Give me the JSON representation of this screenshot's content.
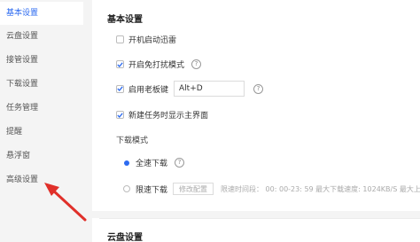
{
  "sidebar": {
    "items": [
      {
        "label": "基本设置",
        "active": true
      },
      {
        "label": "云盘设置"
      },
      {
        "label": "接管设置"
      },
      {
        "label": "下载设置"
      },
      {
        "label": "任务管理"
      },
      {
        "label": "提醒"
      },
      {
        "label": "悬浮窗"
      },
      {
        "label": "高级设置"
      }
    ]
  },
  "basic": {
    "title": "基本设置",
    "autostart": "开机启动迅雷",
    "no_disturb": "开启免打扰模式",
    "boss_key": "启用老板键",
    "boss_key_value": "Alt+D",
    "show_main": "新建任务时显示主界面"
  },
  "download_mode": {
    "title": "下载模式",
    "full_speed": "全速下载",
    "limited": "限速下载",
    "config_button": "修改配置",
    "limit_info": "限速时间段： 00: 00-23: 59  最大下载速度: 1024KB/S  最大上传"
  },
  "cloud": {
    "title": "云盘设置"
  },
  "colors": {
    "accent": "#2d6bf0",
    "arrow": "#e0302a"
  },
  "icons": {
    "help": "?"
  }
}
